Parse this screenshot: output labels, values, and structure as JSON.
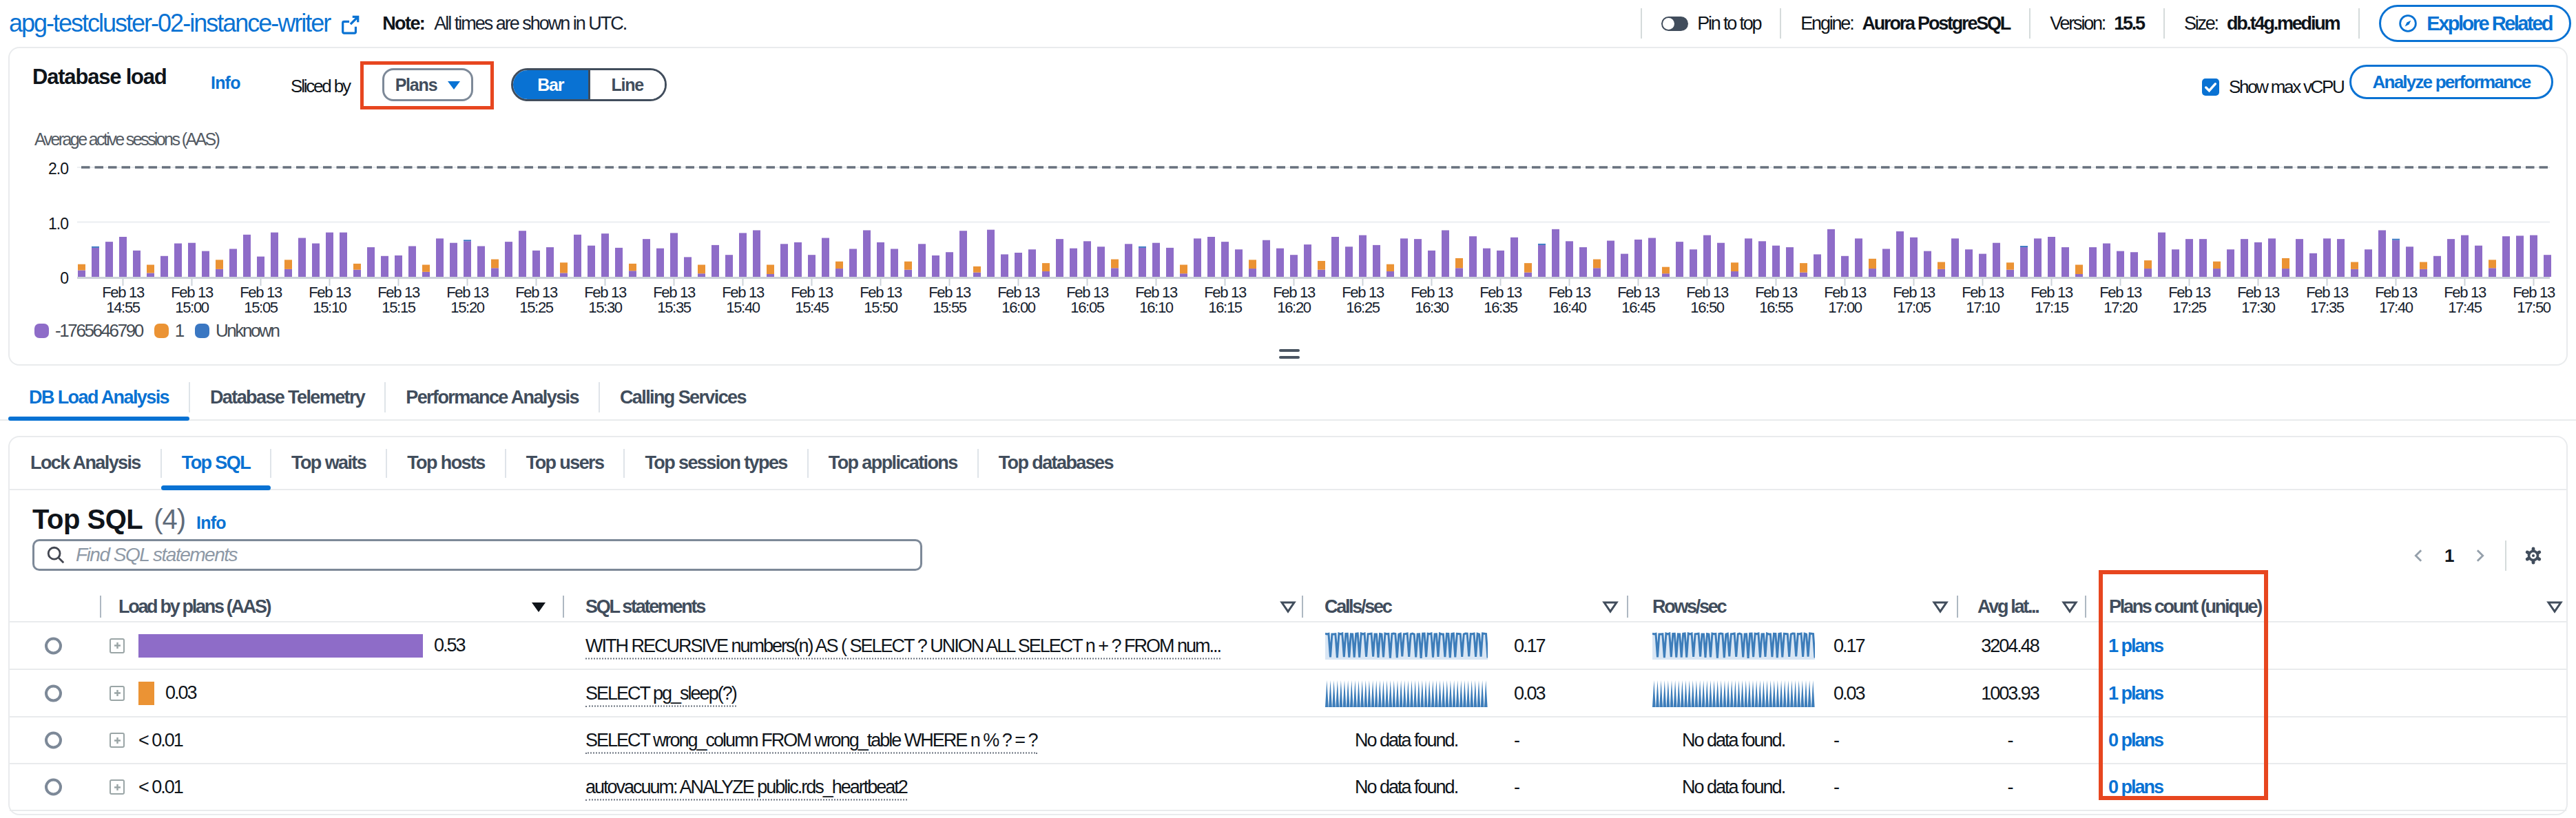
{
  "colors": {
    "accent_blue": "#0972d3",
    "text_dark": "#0f141a",
    "text_header": "#414d5c",
    "text_gray": "#5f6b7a",
    "line_light": "#e9ebed",
    "line_mid": "#d5dbdb",
    "series_purple": "#8e6cc8",
    "series_orange": "#eb9334",
    "series_blue": "#3a77c2",
    "spark_blue": "#3d7dba",
    "spark_fill": "#d9e6f4",
    "annotation_orange": "#e7461f"
  },
  "header": {
    "title": "apg-testcluster-02-instance-writer",
    "note_label": "Note:",
    "note_text": "All times are shown in UTC.",
    "pin_label": "Pin to top",
    "meta": [
      {
        "label": "Engine:",
        "value": "Aurora PostgreSQL"
      },
      {
        "label": "Version:",
        "value": "15.5"
      },
      {
        "label": "Size:",
        "value": "db.t4g.medium"
      }
    ],
    "explore_button": "Explore Related"
  },
  "db_load": {
    "title": "Database load",
    "info_label": "Info",
    "sliced_by_label": "Sliced by",
    "slice_value": "Plans",
    "chart_type_options": [
      "Bar",
      "Line"
    ],
    "chart_type_selected": "Bar",
    "show_max_vcpu_label": "Show max vCPU",
    "show_max_vcpu_checked": true,
    "analyze_button": "Analyze performance"
  },
  "chart_data": {
    "type": "bar",
    "stacked": true,
    "ylabel": "Average active sessions (AAS)",
    "ylim": [
      0,
      2.4
    ],
    "yticks": [
      "0",
      "1.0",
      "2.0"
    ],
    "max_vcpu": 2.0,
    "x_start": "Feb 13 14:52",
    "x_end": "Feb 13 17:52",
    "x_tick_labels": [
      [
        "Feb 13",
        "14:55"
      ],
      [
        "Feb 13",
        "15:00"
      ],
      [
        "Feb 13",
        "15:05"
      ],
      [
        "Feb 13",
        "15:10"
      ],
      [
        "Feb 13",
        "15:15"
      ],
      [
        "Feb 13",
        "15:20"
      ],
      [
        "Feb 13",
        "15:25"
      ],
      [
        "Feb 13",
        "15:30"
      ],
      [
        "Feb 13",
        "15:35"
      ],
      [
        "Feb 13",
        "15:40"
      ],
      [
        "Feb 13",
        "15:45"
      ],
      [
        "Feb 13",
        "15:50"
      ],
      [
        "Feb 13",
        "15:55"
      ],
      [
        "Feb 13",
        "16:00"
      ],
      [
        "Feb 13",
        "16:05"
      ],
      [
        "Feb 13",
        "16:10"
      ],
      [
        "Feb 13",
        "16:15"
      ],
      [
        "Feb 13",
        "16:20"
      ],
      [
        "Feb 13",
        "16:25"
      ],
      [
        "Feb 13",
        "16:30"
      ],
      [
        "Feb 13",
        "16:35"
      ],
      [
        "Feb 13",
        "16:40"
      ],
      [
        "Feb 13",
        "16:45"
      ],
      [
        "Feb 13",
        "16:50"
      ],
      [
        "Feb 13",
        "16:55"
      ],
      [
        "Feb 13",
        "17:00"
      ],
      [
        "Feb 13",
        "17:05"
      ],
      [
        "Feb 13",
        "17:10"
      ],
      [
        "Feb 13",
        "17:15"
      ],
      [
        "Feb 13",
        "17:20"
      ],
      [
        "Feb 13",
        "17:25"
      ],
      [
        "Feb 13",
        "17:30"
      ],
      [
        "Feb 13",
        "17:35"
      ],
      [
        "Feb 13",
        "17:40"
      ],
      [
        "Feb 13",
        "17:45"
      ],
      [
        "Feb 13",
        "17:50"
      ]
    ],
    "x_tick_indices": [
      3,
      8,
      13,
      18,
      23,
      28,
      33,
      38,
      43,
      48,
      53,
      58,
      63,
      68,
      73,
      78,
      83,
      88,
      93,
      98,
      103,
      108,
      113,
      118,
      123,
      128,
      133,
      138,
      143,
      148,
      153,
      158,
      163,
      168,
      173,
      178
    ],
    "legend": [
      {
        "name": "-1765646790",
        "color": "#8e6cc8"
      },
      {
        "name": "1",
        "color": "#eb9334"
      },
      {
        "name": "Unknown",
        "color": "#3a77c2"
      }
    ],
    "series": [
      {
        "name": "-1765646790",
        "color": "#8e6cc8",
        "values": [
          0.12,
          0.53,
          0.64,
          0.73,
          0.48,
          0.07,
          0.38,
          0.61,
          0.62,
          0.47,
          0.14,
          0.51,
          0.77,
          0.37,
          0.81,
          0.14,
          0.71,
          0.61,
          0.81,
          0.81,
          0.13,
          0.54,
          0.38,
          0.39,
          0.56,
          0.09,
          0.7,
          0.62,
          0.65,
          0.56,
          0.16,
          0.64,
          0.84,
          0.48,
          0.54,
          0.07,
          0.77,
          0.57,
          0.79,
          0.53,
          0.11,
          0.69,
          0.52,
          0.8,
          0.36,
          0.06,
          0.58,
          0.4,
          0.8,
          0.85,
          0.05,
          0.6,
          0.63,
          0.4,
          0.71,
          0.15,
          0.51,
          0.85,
          0.63,
          0.51,
          0.13,
          0.6,
          0.39,
          0.45,
          0.84,
          0.08,
          0.86,
          0.41,
          0.44,
          0.5,
          0.1,
          0.69,
          0.52,
          0.65,
          0.55,
          0.16,
          0.6,
          0.53,
          0.62,
          0.53,
          0.06,
          0.7,
          0.73,
          0.64,
          0.5,
          0.15,
          0.67,
          0.52,
          0.4,
          0.59,
          0.13,
          0.73,
          0.55,
          0.76,
          0.58,
          0.1,
          0.7,
          0.69,
          0.48,
          0.85,
          0.16,
          0.74,
          0.52,
          0.48,
          0.72,
          0.08,
          0.58,
          0.87,
          0.65,
          0.54,
          0.16,
          0.66,
          0.42,
          0.68,
          0.71,
          0.06,
          0.64,
          0.5,
          0.76,
          0.62,
          0.1,
          0.7,
          0.65,
          0.57,
          0.54,
          0.08,
          0.41,
          0.87,
          0.38,
          0.7,
          0.15,
          0.51,
          0.83,
          0.72,
          0.47,
          0.14,
          0.7,
          0.5,
          0.42,
          0.62,
          0.13,
          0.54,
          0.7,
          0.73,
          0.54,
          0.05,
          0.54,
          0.61,
          0.47,
          0.45,
          0.15,
          0.81,
          0.5,
          0.69,
          0.69,
          0.15,
          0.5,
          0.69,
          0.63,
          0.7,
          0.15,
          0.69,
          0.43,
          0.7,
          0.69,
          0.14,
          0.5,
          0.85,
          0.67,
          0.55,
          0.14,
          0.38,
          0.69,
          0.76,
          0.57,
          0.16,
          0.74,
          0.75,
          0.76,
          0.4
        ]
      },
      {
        "name": "1",
        "color": "#eb9334",
        "values": [
          0.11,
          0,
          0,
          0,
          0,
          0.15,
          0,
          0,
          0,
          0,
          0.17,
          0,
          0,
          0,
          0,
          0.17,
          0,
          0,
          0,
          0,
          0.11,
          0,
          0,
          0,
          0,
          0.13,
          0,
          0,
          0,
          0,
          0.16,
          0,
          0,
          0,
          0,
          0.19,
          0,
          0,
          0,
          0,
          0.13,
          0,
          0,
          0,
          0,
          0.16,
          0,
          0,
          0,
          0,
          0.17,
          0,
          0,
          0,
          0,
          0.13,
          0,
          0,
          0,
          0,
          0.15,
          0,
          0,
          0,
          0,
          0.11,
          0,
          0,
          0,
          0,
          0.15,
          0,
          0,
          0,
          0,
          0.16,
          0,
          0,
          0,
          0,
          0.16,
          0,
          0,
          0,
          0,
          0.16,
          0,
          0,
          0,
          0,
          0.16,
          0,
          0,
          0,
          0,
          0.13,
          0,
          0,
          0,
          0,
          0.18,
          0,
          0,
          0,
          0,
          0.17,
          0,
          0,
          0,
          0,
          0.16,
          0,
          0,
          0,
          0,
          0.12,
          0,
          0,
          0,
          0,
          0.16,
          0,
          0,
          0,
          0,
          0.17,
          0,
          0,
          0,
          0,
          0.18,
          0,
          0,
          0,
          0,
          0.13,
          0,
          0,
          0,
          0,
          0.13,
          0,
          0,
          0,
          0,
          0.17,
          0,
          0,
          0,
          0,
          0.15,
          0,
          0,
          0,
          0,
          0.13,
          0,
          0,
          0,
          0,
          0.19,
          0,
          0,
          0,
          0,
          0.13,
          0,
          0,
          0,
          0,
          0.13,
          0,
          0,
          0,
          0,
          0.15,
          0,
          0,
          0,
          0
        ]
      },
      {
        "name": "Unknown",
        "color": "#3a77c2",
        "values": [
          0,
          0.025,
          0,
          0,
          0,
          0,
          0,
          0,
          0,
          0,
          0,
          0,
          0,
          0,
          0,
          0,
          0,
          0,
          0,
          0,
          0,
          0,
          0,
          0,
          0,
          0,
          0,
          0,
          0.025,
          0,
          0,
          0,
          0,
          0,
          0,
          0,
          0,
          0,
          0,
          0,
          0,
          0,
          0,
          0,
          0,
          0,
          0,
          0,
          0,
          0,
          0,
          0,
          0,
          0,
          0,
          0,
          0,
          0,
          0,
          0,
          0,
          0,
          0,
          0,
          0,
          0,
          0,
          0,
          0,
          0,
          0,
          0,
          0,
          0,
          0,
          0,
          0,
          0.025,
          0,
          0,
          0,
          0,
          0,
          0,
          0,
          0,
          0,
          0,
          0,
          0,
          0,
          0,
          0,
          0,
          0,
          0,
          0,
          0,
          0,
          0,
          0,
          0,
          0,
          0,
          0,
          0,
          0.025,
          0,
          0,
          0,
          0,
          0,
          0,
          0,
          0,
          0,
          0,
          0,
          0,
          0,
          0,
          0,
          0,
          0,
          0,
          0,
          0,
          0,
          0,
          0,
          0,
          0,
          0,
          0,
          0,
          0,
          0,
          0,
          0,
          0,
          0,
          0.025,
          0,
          0,
          0,
          0,
          0,
          0,
          0,
          0,
          0,
          0,
          0,
          0,
          0,
          0,
          0,
          0,
          0,
          0,
          0,
          0,
          0,
          0,
          0,
          0,
          0,
          0,
          0.025,
          0,
          0,
          0,
          0,
          0,
          0,
          0,
          0,
          0,
          0,
          0
        ]
      }
    ]
  },
  "tabs": {
    "items": [
      "DB Load Analysis",
      "Database Telemetry",
      "Performance Analysis",
      "Calling Services"
    ],
    "active": 0
  },
  "subtabs": {
    "items": [
      "Lock Analysis",
      "Top SQL",
      "Top waits",
      "Top hosts",
      "Top users",
      "Top session types",
      "Top applications",
      "Top databases"
    ],
    "active": 1
  },
  "top_sql": {
    "title": "Top SQL",
    "count": "(4)",
    "info_label": "Info",
    "search_placeholder": "Find SQL statements",
    "page": "1",
    "columns": [
      {
        "label": "Load by plans (AAS)",
        "sort": "desc"
      },
      {
        "label": "SQL statements",
        "filter": true
      },
      {
        "label": "Calls/sec",
        "filter": true
      },
      {
        "label": "Rows/sec",
        "filter": true
      },
      {
        "label": "Avg lat...",
        "filter": true
      },
      {
        "label": "Plans count (unique)",
        "filter": true
      }
    ],
    "rows": [
      {
        "load_label": "0.53",
        "load_frac": 0.53,
        "load_color": "#8e6cc8",
        "sql": "WITH RECURSIVE numbers(n) AS ( SELECT ? UNION ALL SELECT n + ? FROM num...",
        "calls": {
          "spark": "dips",
          "value": "0.17"
        },
        "rows": {
          "spark": "dips",
          "value": "0.17"
        },
        "avg_latency": "3204.48",
        "plans": "1 plans"
      },
      {
        "load_label": "0.03",
        "load_frac": 0.03,
        "load_color": "#eb9334",
        "sql": "SELECT pg_sleep(?)",
        "calls": {
          "spark": "comb",
          "value": "0.03"
        },
        "rows": {
          "spark": "comb",
          "value": "0.03"
        },
        "avg_latency": "1003.93",
        "plans": "1 plans"
      },
      {
        "load_label": "< 0.01",
        "load_frac": 0,
        "sql": "SELECT wrong_column FROM wrong_table WHERE n % ? = ?",
        "calls": {
          "nodata": "No data found.",
          "value": "-"
        },
        "rows": {
          "nodata": "No data found.",
          "value": "-"
        },
        "avg_latency": "-",
        "plans": "0 plans"
      },
      {
        "load_label": "< 0.01",
        "load_frac": 0,
        "sql": "autovacuum: ANALYZE public.rds_heartbeat2",
        "calls": {
          "nodata": "No data found.",
          "value": "-"
        },
        "rows": {
          "nodata": "No data found.",
          "value": "-"
        },
        "avg_latency": "-",
        "plans": "0 plans"
      }
    ]
  },
  "sparkline_data": {
    "dips": [
      0.997,
      0.973,
      0.988,
      0.042,
      0.974,
      0.976,
      0.983,
      0.022,
      0.997,
      0.973,
      0.999,
      0.05,
      0.985,
      0.992,
      0.036,
      0.976,
      0.971,
      0.037,
      0.989,
      0.999,
      0.036,
      0.999,
      0.978,
      0.999,
      0.057,
      0.975,
      0.984,
      0.994,
      0.068,
      0.975,
      0.975,
      0.032,
      0.987,
      0.972,
      0.043,
      0.998,
      0.978,
      0.988,
      0.011,
      0.986,
      0.997,
      0.984,
      0.022,
      0.973,
      0.994,
      0.071,
      0.977,
      0.986,
      0.998,
      0.059,
      0.975,
      0.999,
      0.972,
      0.042,
      0.975,
      0.977,
      0.001,
      0.994,
      0.998,
      0.054,
      0.992,
      0.98,
      0.999,
      0.038,
      0.971,
      0.978,
      0.055,
      0.999,
      0.976,
      0.973,
      0.053,
      0.991,
      0.987,
      0.024,
      0.983,
      0.997,
      0.044,
      0.99,
      0.982,
      0.975,
      0.062,
      0.972,
      0.999,
      0.997,
      0.075,
      0.983,
      0.979,
      0.996,
      0.061,
      0.995,
      0.973,
      0.063,
      0.999,
      0.992,
      0.983,
      0.017
    ],
    "comb_teeth": 46
  }
}
